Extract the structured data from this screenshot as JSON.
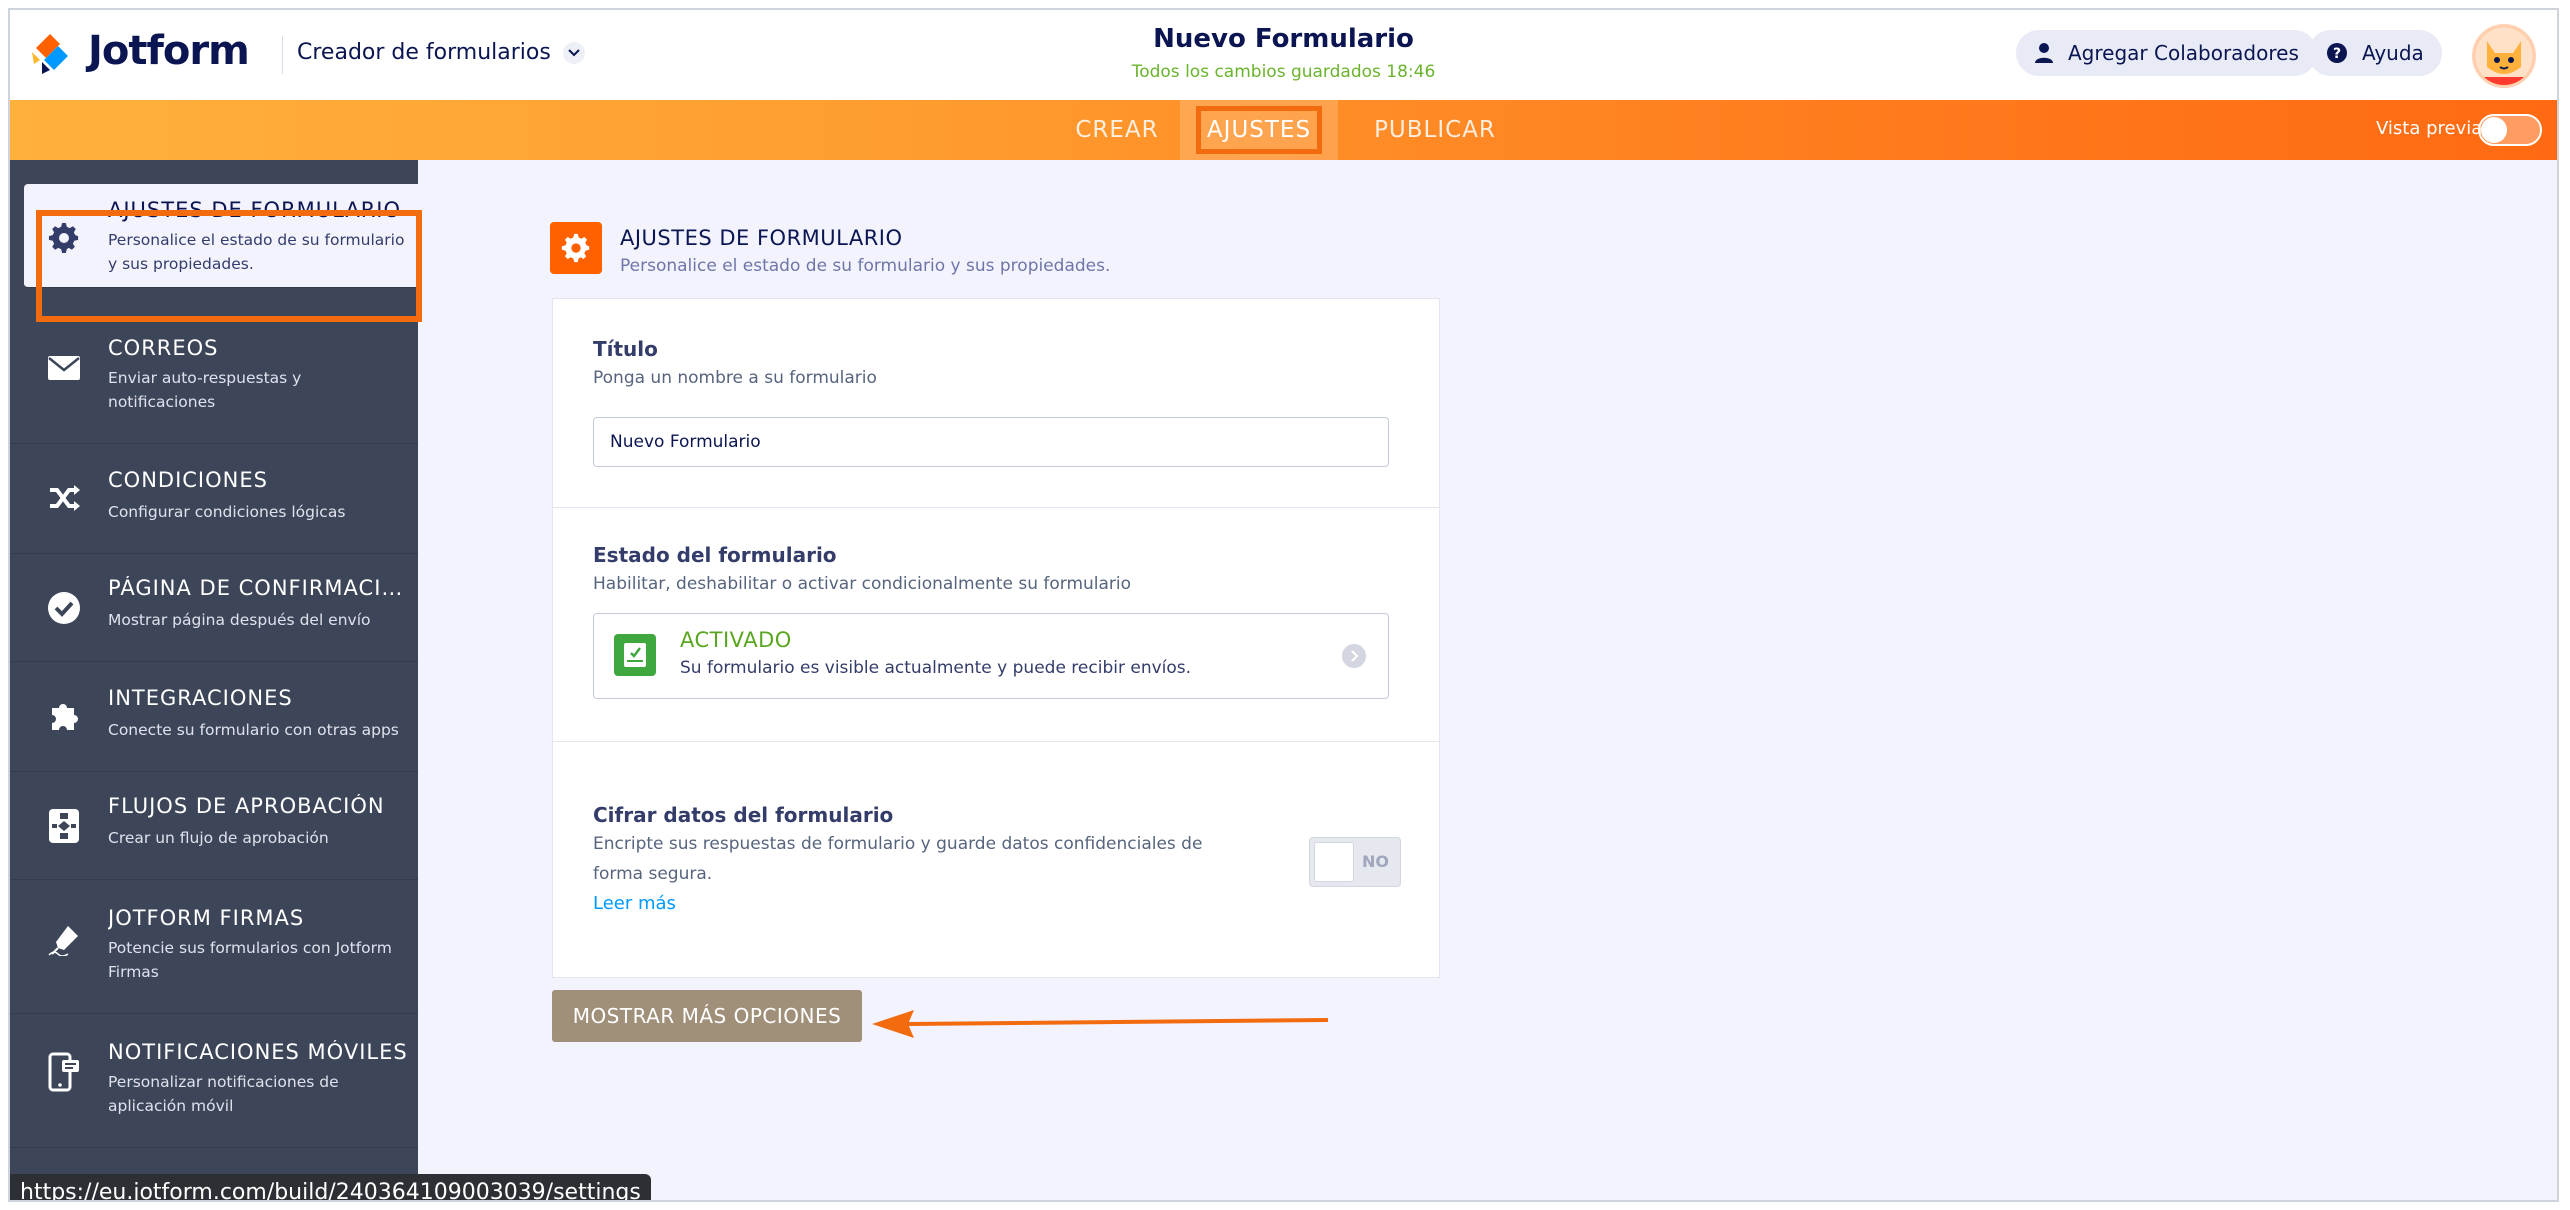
{
  "header": {
    "brand": "Jotform",
    "builder_label": "Creador de formularios",
    "form_title": "Nuevo Formulario",
    "save_status": "Todos los cambios guardados 18:46",
    "collaborators_label": "Agregar Colaboradores",
    "help_label": "Ayuda"
  },
  "nav": {
    "tabs": [
      "CREAR",
      "AJUSTES",
      "PUBLICAR"
    ],
    "active_tab": "AJUSTES",
    "preview_label": "Vista previa"
  },
  "sidebar": {
    "items": [
      {
        "title": "AJUSTES DE FORMULARIO",
        "desc": "Personalice el estado de su formulario y sus propiedades.",
        "icon": "gear-icon"
      },
      {
        "title": "CORREOS",
        "desc": "Enviar auto-respuestas y notificaciones",
        "icon": "envelope-icon"
      },
      {
        "title": "CONDICIONES",
        "desc": "Configurar condiciones lógicas",
        "icon": "shuffle-icon"
      },
      {
        "title": "PÁGINA DE CONFIRMACIÓN",
        "desc": "Mostrar página después del envío",
        "icon": "check-circle-icon"
      },
      {
        "title": "INTEGRACIONES",
        "desc": "Conecte su formulario con otras apps",
        "icon": "puzzle-icon"
      },
      {
        "title": "FLUJOS DE APROBACIÓN",
        "desc": "Crear un flujo de aprobación",
        "icon": "flow-icon"
      },
      {
        "title": "JOTFORM FIRMAS",
        "desc": "Potencie sus formularios con Jotform Firmas",
        "icon": "pen-sign-icon"
      },
      {
        "title": "NOTIFICACIONES MÓVILES",
        "desc": "Personalizar notificaciones de aplicación móvil",
        "icon": "mobile-icon"
      }
    ]
  },
  "main": {
    "section_title": "AJUSTES DE FORMULARIO",
    "section_sub": "Personalice el estado de su formulario y sus propiedades.",
    "title_field": {
      "label": "Título",
      "help": "Ponga un nombre a su formulario",
      "value": "Nuevo Formulario"
    },
    "status": {
      "label": "Estado del formulario",
      "help": "Habilitar, deshabilitar o activar condicionalmente su formulario",
      "value": "ACTIVADO",
      "desc": "Su formulario es visible actualmente y puede recibir envíos."
    },
    "encrypt": {
      "label": "Cifrar datos del formulario",
      "help_line1": "Encripte sus respuestas de formulario y guarde datos confidenciales de",
      "help_line2": "forma segura.",
      "link": "Leer más",
      "toggle": "NO"
    },
    "more_button": "MOSTRAR MÁS OPCIONES"
  },
  "status_bar": {
    "url": "https://eu.jotform.com/build/240364109003039/settings"
  },
  "colors": {
    "accent": "#ff6100",
    "sidebar": "#3d4659",
    "success": "#5aa620",
    "link": "#0099ff"
  }
}
